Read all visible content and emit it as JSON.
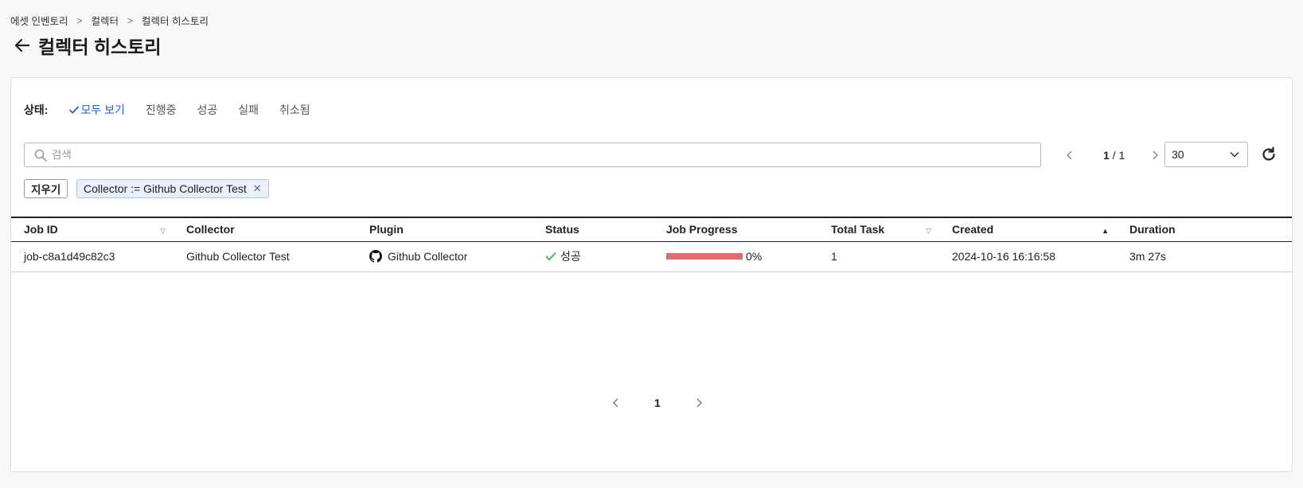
{
  "breadcrumb": [
    "에셋 인벤토리",
    "컬렉터",
    "컬렉터 히스토리"
  ],
  "page_title": "컬렉터 히스토리",
  "status_filter": {
    "label": "상태:",
    "tabs": [
      "모두 보기",
      "진행중",
      "성공",
      "실패",
      "취소됨"
    ],
    "active": "모두 보기"
  },
  "search": {
    "placeholder": "검색",
    "value": ""
  },
  "pagination_top": {
    "current": "1",
    "total": "1",
    "page_size": "30"
  },
  "filters": {
    "clear_label": "지우기",
    "tags": [
      "Collector := Github Collector Test"
    ]
  },
  "table": {
    "columns": [
      "Job ID",
      "Collector",
      "Plugin",
      "Status",
      "Job Progress",
      "Total Task",
      "Created",
      "Duration"
    ],
    "rows": [
      {
        "job_id": "job-c8a1d49c82c3",
        "collector": "Github Collector Test",
        "plugin": "Github Collector",
        "status": "성공",
        "progress": "0%",
        "total_task": "1",
        "created": "2024-10-16 16:16:58",
        "duration": "3m 27s"
      }
    ]
  },
  "pagination_bottom": {
    "page": "1"
  },
  "colors": {
    "accent": "#1e5cd6",
    "success": "#3fb950",
    "progress_bar": "#e46b6b",
    "tag_bg": "#e7f0fc"
  }
}
